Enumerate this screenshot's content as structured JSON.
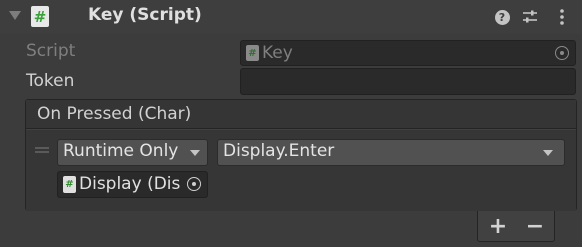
{
  "header": {
    "title": "Key (Script)",
    "script_icon_glyph": "#",
    "icons": [
      "help-icon",
      "preset-icon",
      "more-icon",
      "foldout-arrow-icon",
      "script-icon"
    ]
  },
  "fields": {
    "script_label": "Script",
    "script_value": "Key",
    "token_label": "Token",
    "token_value": ""
  },
  "event": {
    "header": "On Pressed (Char)",
    "call_state": "Runtime Only",
    "function": "Display.Enter",
    "target_object": "Display (Dis",
    "add_label": "+",
    "remove_label": "−"
  },
  "colors": {
    "background": "#3c3c3c",
    "field": "#2a2a2a",
    "dropdown": "#515151",
    "script_icon_green": "#3aa13a"
  }
}
